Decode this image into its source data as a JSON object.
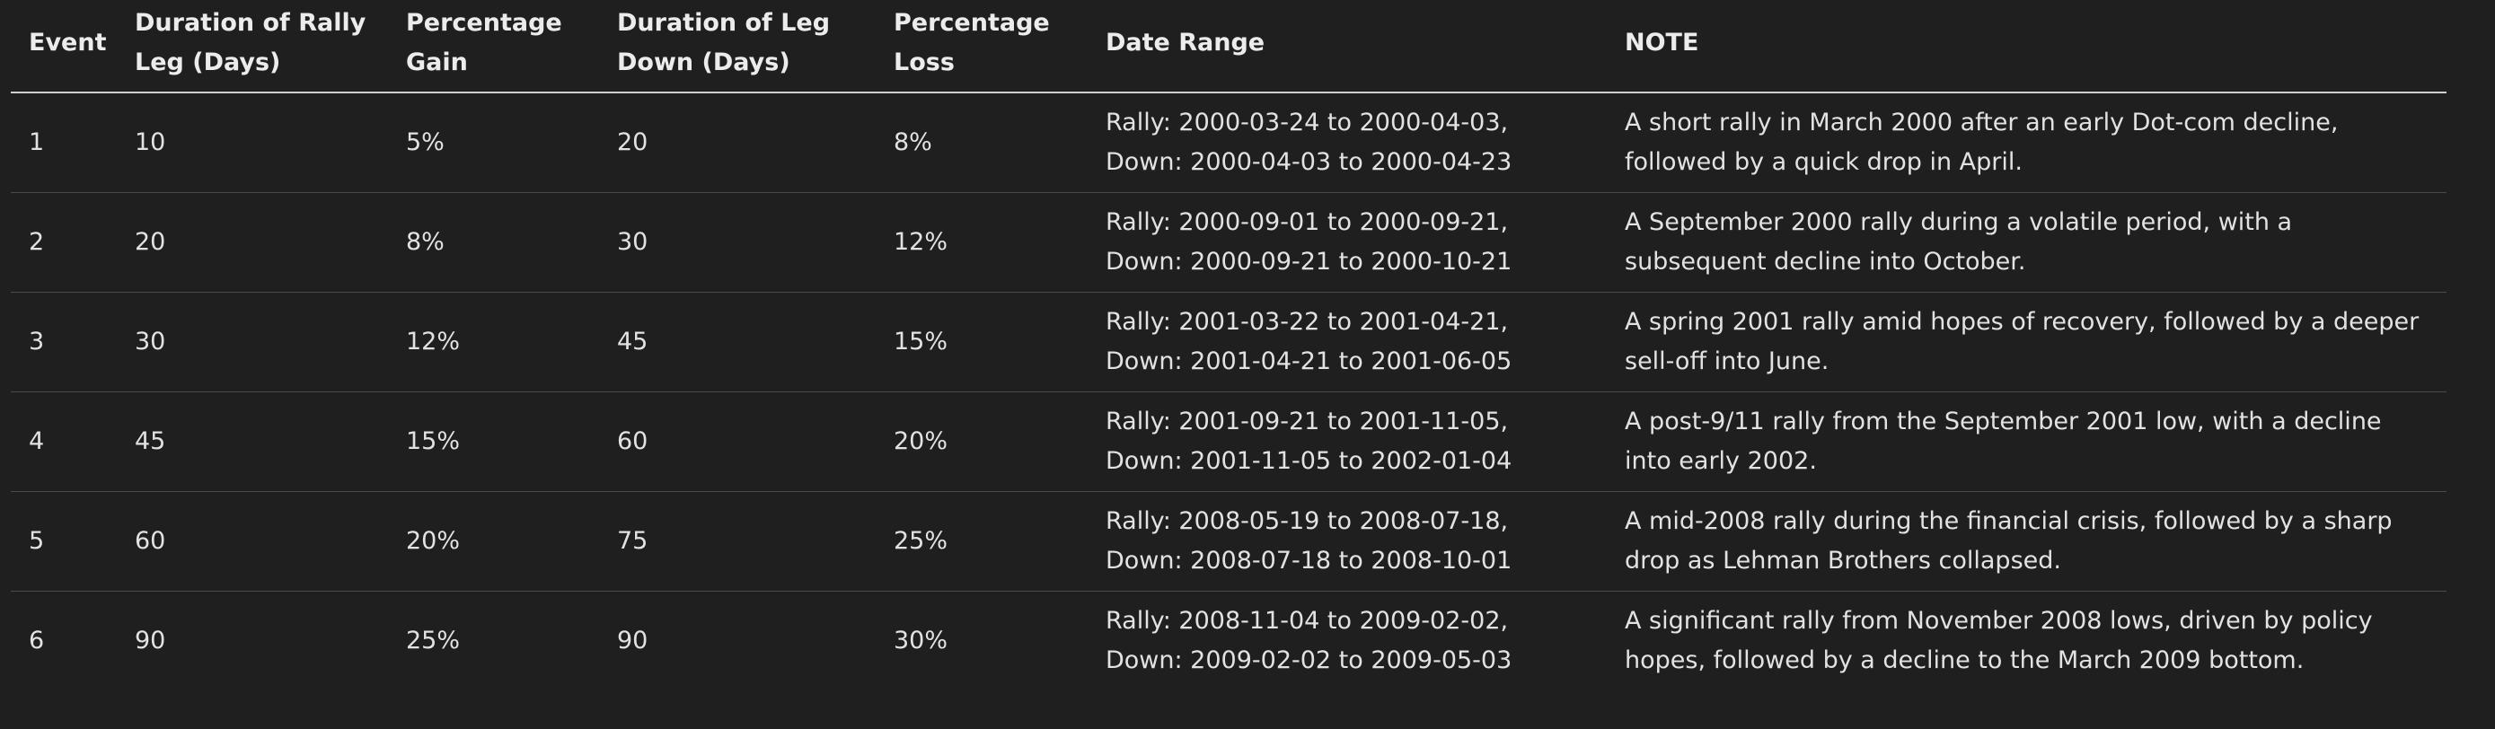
{
  "table": {
    "headers": [
      "Event",
      "Duration of Rally Leg (Days)",
      "Percentage Gain",
      "Duration of Leg Down (Days)",
      "Percentage Loss",
      "Date Range",
      "NOTE"
    ],
    "rows": [
      [
        "1",
        "10",
        "5%",
        "20",
        "8%",
        "Rally: 2000-03-24 to 2000-04-03, Down: 2000-04-03 to 2000-04-23",
        "A short rally in March 2000 after an early Dot-com decline, followed by a quick drop in April."
      ],
      [
        "2",
        "20",
        "8%",
        "30",
        "12%",
        "Rally: 2000-09-01 to 2000-09-21, Down: 2000-09-21 to 2000-10-21",
        "A September 2000 rally during a volatile period, with a subsequent decline into October."
      ],
      [
        "3",
        "30",
        "12%",
        "45",
        "15%",
        "Rally: 2001-03-22 to 2001-04-21, Down: 2001-04-21 to 2001-06-05",
        "A spring 2001 rally amid hopes of recovery, followed by a deeper sell-off into June."
      ],
      [
        "4",
        "45",
        "15%",
        "60",
        "20%",
        "Rally: 2001-09-21 to 2001-11-05, Down: 2001-11-05 to 2002-01-04",
        "A post-9/11 rally from the September 2001 low, with a decline into early 2002."
      ],
      [
        "5",
        "60",
        "20%",
        "75",
        "25%",
        "Rally: 2008-05-19 to 2008-07-18, Down: 2008-07-18 to 2008-10-01",
        "A mid-2008 rally during the financial crisis, followed by a sharp drop as Lehman Brothers collapsed."
      ],
      [
        "6",
        "90",
        "25%",
        "90",
        "30%",
        "Rally: 2008-11-04 to 2009-02-02, Down: 2009-02-02 to 2009-05-03",
        "A significant rally from November 2008 lows, driven by policy hopes, followed by a decline to the March 2009 bottom."
      ]
    ]
  }
}
